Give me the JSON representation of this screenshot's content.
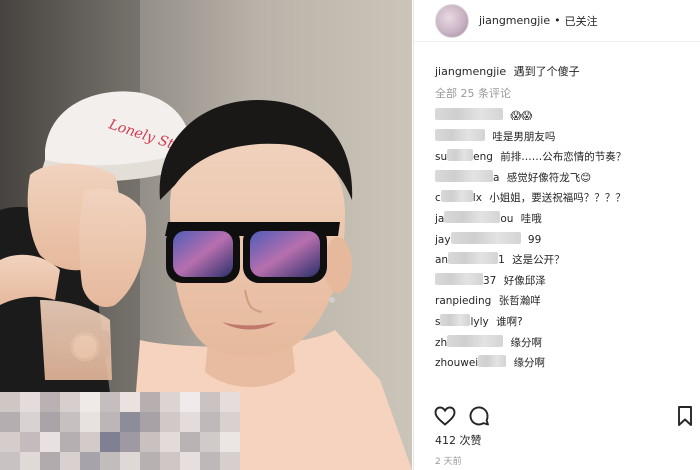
{
  "post": {
    "username": "jiangmengjie",
    "separator": "•",
    "follow_status": "已关注",
    "caption_text": "遇到了个傻子",
    "view_all_comments": "全部 25 条评论",
    "comments": [
      {
        "user": "",
        "text": "😱😱"
      },
      {
        "user": "",
        "text": "哇是男朋友吗"
      },
      {
        "user": "su",
        "user_tail": "eng",
        "text": "前排……公布恋情的节奏？"
      },
      {
        "user": "",
        "user_tail": "a",
        "text": "感觉好像符龙飞😊"
      },
      {
        "user": "c",
        "user_tail": "lx",
        "text": "小姐姐，要送祝福吗？？？？"
      },
      {
        "user": "ja",
        "user_tail": "ou",
        "text": "哇哦"
      },
      {
        "user": "jay",
        "user_tail": "",
        "text": "99"
      },
      {
        "user": "an",
        "user_tail": "1",
        "text": "这是公开？"
      },
      {
        "user": "",
        "user_tail": "37",
        "text": "好像邱泽"
      },
      {
        "user": "ranpieding",
        "user_tail": "",
        "text": "张哲瀚咩"
      },
      {
        "user": "s",
        "user_tail": "lyly",
        "text": "谁啊?"
      },
      {
        "user": "zh",
        "user_tail": "",
        "text": "缘分啊"
      },
      {
        "user": "zhouwei",
        "user_tail": "",
        "text": "缘分啊"
      }
    ],
    "likes": "412 次赞",
    "timestamp": "2 天前"
  },
  "hat_text": "Lonely Stars",
  "icons": {
    "like": "heart-icon",
    "comment": "comment-bubble-icon",
    "save": "bookmark-icon"
  }
}
